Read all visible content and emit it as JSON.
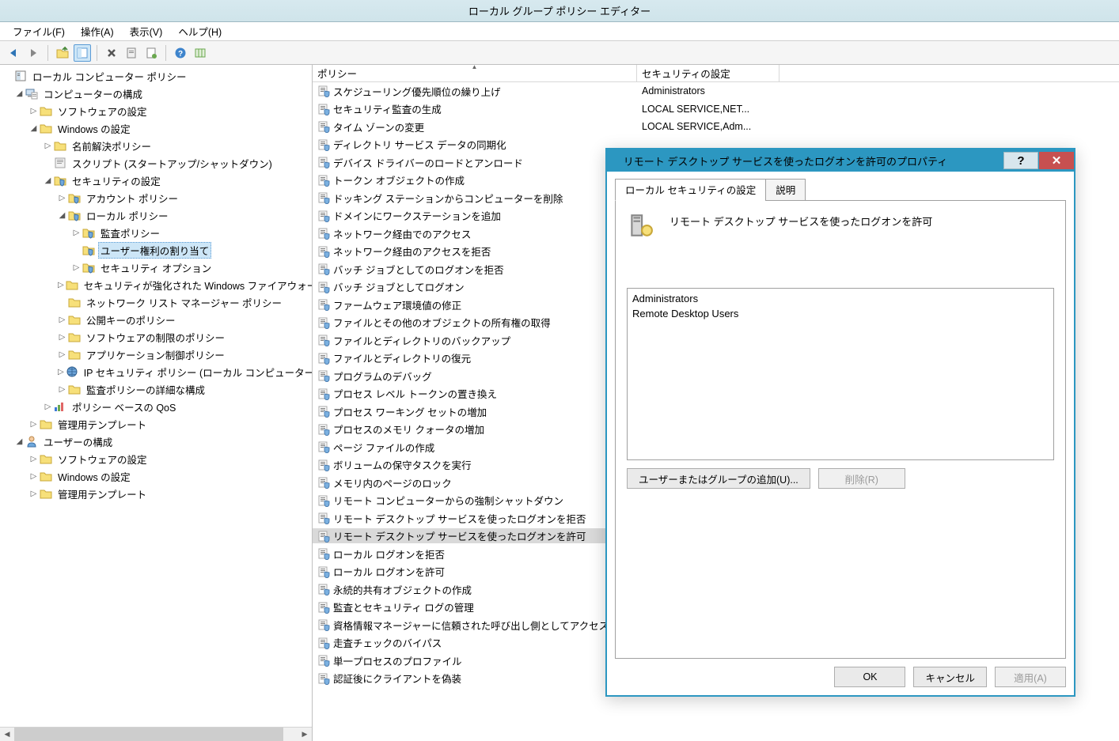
{
  "window": {
    "title": "ローカル グループ ポリシー エディター"
  },
  "menu": {
    "file": "ファイル(F)",
    "action": "操作(A)",
    "view": "表示(V)",
    "help": "ヘルプ(H)"
  },
  "tree": {
    "root": "ローカル コンピューター ポリシー",
    "computer_config": "コンピューターの構成",
    "software_settings": "ソフトウェアの設定",
    "windows_settings": "Windows の設定",
    "name_resolution": "名前解決ポリシー",
    "scripts": "スクリプト (スタートアップ/シャットダウン)",
    "security_settings": "セキュリティの設定",
    "account_policies": "アカウント ポリシー",
    "local_policies": "ローカル ポリシー",
    "audit_policy": "監査ポリシー",
    "user_rights": "ユーザー権利の割り当て",
    "security_options": "セキュリティ オプション",
    "wfas": "セキュリティが強化された Windows ファイアウォール",
    "nlm": "ネットワーク リスト マネージャー ポリシー",
    "pk_policies": "公開キーのポリシー",
    "srp": "ソフトウェアの制限のポリシー",
    "acp": "アプリケーション制御ポリシー",
    "ipsec": "IP セキュリティ ポリシー (ローカル コンピューター)",
    "adv_audit": "監査ポリシーの詳細な構成",
    "qos": "ポリシー ベースの QoS",
    "admin_templates": "管理用テンプレート",
    "user_config": "ユーザーの構成",
    "u_software": "ソフトウェアの設定",
    "u_windows": "Windows の設定",
    "u_admin": "管理用テンプレート"
  },
  "list_header": {
    "policy": "ポリシー",
    "security": "セキュリティの設定"
  },
  "policies": [
    {
      "name": "スケジューリング優先順位の繰り上げ",
      "setting": "Administrators"
    },
    {
      "name": "セキュリティ監査の生成",
      "setting": "LOCAL SERVICE,NET..."
    },
    {
      "name": "タイム ゾーンの変更",
      "setting": "LOCAL SERVICE,Adm..."
    },
    {
      "name": "ディレクトリ サービス データの同期化",
      "setting": ""
    },
    {
      "name": "デバイス ドライバーのロードとアンロード",
      "setting": ""
    },
    {
      "name": "トークン オブジェクトの作成",
      "setting": ""
    },
    {
      "name": "ドッキング ステーションからコンピューターを削除",
      "setting": ""
    },
    {
      "name": "ドメインにワークステーションを追加",
      "setting": ""
    },
    {
      "name": "ネットワーク経由でのアクセス",
      "setting": ""
    },
    {
      "name": "ネットワーク経由のアクセスを拒否",
      "setting": ""
    },
    {
      "name": "バッチ ジョブとしてのログオンを拒否",
      "setting": ""
    },
    {
      "name": "バッチ ジョブとしてログオン",
      "setting": ""
    },
    {
      "name": "ファームウェア環境値の修正",
      "setting": ""
    },
    {
      "name": "ファイルとその他のオブジェクトの所有権の取得",
      "setting": ""
    },
    {
      "name": "ファイルとディレクトリのバックアップ",
      "setting": ""
    },
    {
      "name": "ファイルとディレクトリの復元",
      "setting": ""
    },
    {
      "name": "プログラムのデバッグ",
      "setting": ""
    },
    {
      "name": "プロセス レベル トークンの置き換え",
      "setting": ""
    },
    {
      "name": "プロセス ワーキング セットの増加",
      "setting": ""
    },
    {
      "name": "プロセスのメモリ クォータの増加",
      "setting": ""
    },
    {
      "name": "ページ ファイルの作成",
      "setting": ""
    },
    {
      "name": "ボリュームの保守タスクを実行",
      "setting": ""
    },
    {
      "name": "メモリ内のページのロック",
      "setting": ""
    },
    {
      "name": "リモート コンピューターからの強制シャットダウン",
      "setting": ""
    },
    {
      "name": "リモート デスクトップ サービスを使ったログオンを拒否",
      "setting": ""
    },
    {
      "name": "リモート デスクトップ サービスを使ったログオンを許可",
      "setting": "",
      "selected": true
    },
    {
      "name": "ローカル ログオンを拒否",
      "setting": ""
    },
    {
      "name": "ローカル ログオンを許可",
      "setting": ""
    },
    {
      "name": "永続的共有オブジェクトの作成",
      "setting": ""
    },
    {
      "name": "監査とセキュリティ ログの管理",
      "setting": ""
    },
    {
      "name": "資格情報マネージャーに信頼された呼び出し側としてアクセス",
      "setting": ""
    },
    {
      "name": "走査チェックのバイパス",
      "setting": ""
    },
    {
      "name": "単一プロセスのプロファイル",
      "setting": ""
    },
    {
      "name": "認証後にクライアントを偽装",
      "setting": ""
    }
  ],
  "dialog": {
    "title": "リモート デスクトップ サービスを使ったログオンを許可のプロパティ",
    "tab_local": "ローカル セキュリティの設定",
    "tab_explain": "説明",
    "policy_name": "リモート デスクトップ サービスを使ったログオンを許可",
    "members": [
      "Administrators",
      "Remote Desktop Users"
    ],
    "add_btn": "ユーザーまたはグループの追加(U)...",
    "remove_btn": "削除(R)",
    "ok": "OK",
    "cancel": "キャンセル",
    "apply": "適用(A)"
  }
}
